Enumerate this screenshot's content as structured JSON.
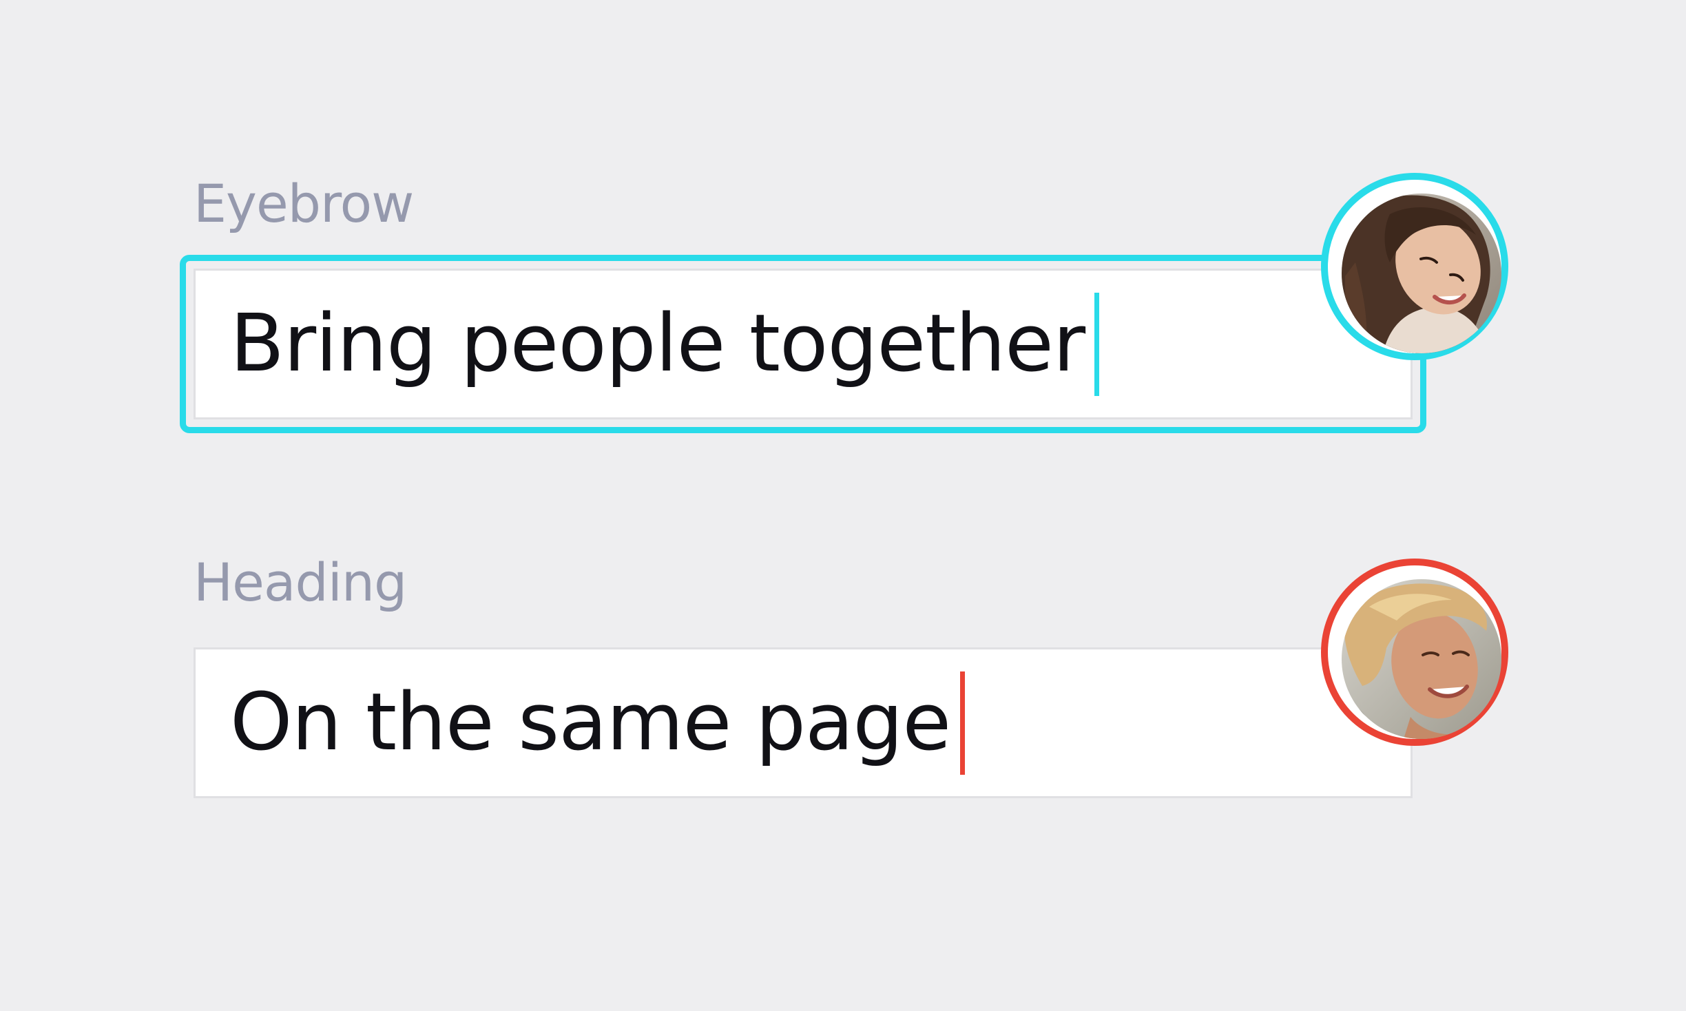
{
  "colors": {
    "background": "#eeeef0",
    "label": "#9599ad",
    "text": "#111116",
    "user1_accent": "#29dbe9",
    "user2_accent": "#ea4335"
  },
  "fields": [
    {
      "label": "Eyebrow",
      "value": "Bring people together",
      "focused": true,
      "collaborator_icon": "woman-avatar"
    },
    {
      "label": "Heading",
      "value": "On the same page",
      "focused": false,
      "collaborator_icon": "man-avatar"
    }
  ]
}
